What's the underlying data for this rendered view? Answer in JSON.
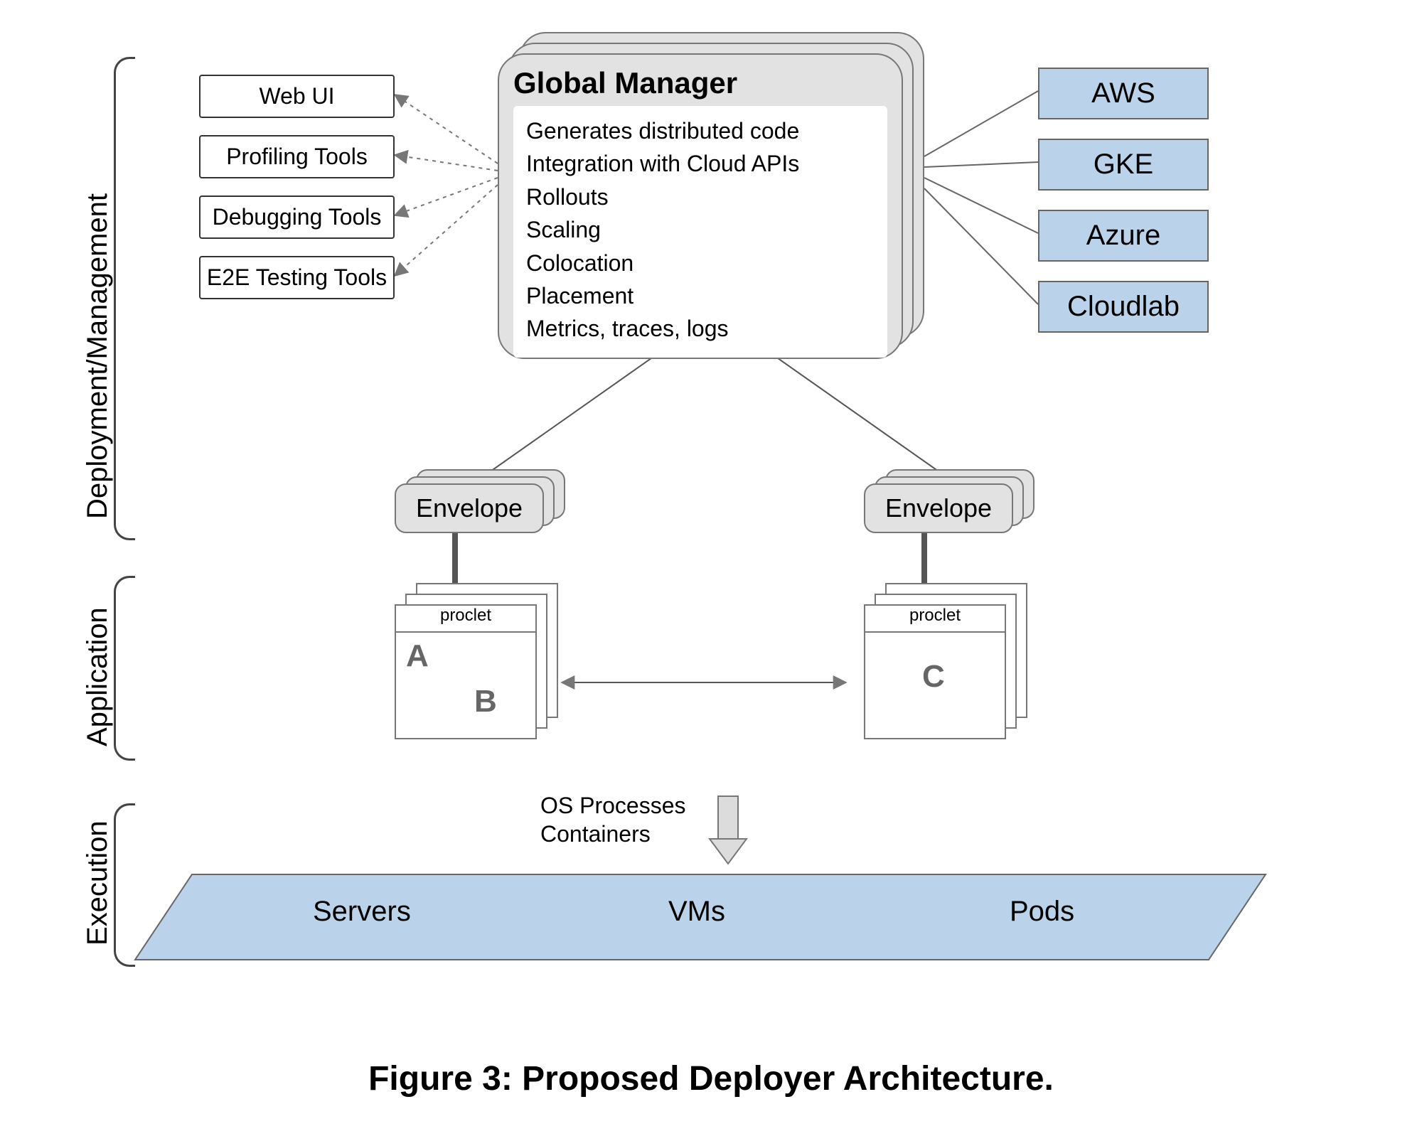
{
  "sections": {
    "deployment": "Deployment/Management",
    "application": "Application",
    "execution": "Execution"
  },
  "tools": [
    "Web UI",
    "Profiling Tools",
    "Debugging Tools",
    "E2E Testing Tools"
  ],
  "globalManager": {
    "title": "Global Manager",
    "items": [
      "Generates distributed code",
      "Integration with Cloud APIs",
      "Rollouts",
      "Scaling",
      "Colocation",
      "Placement",
      "Metrics, traces, logs"
    ]
  },
  "clouds": [
    "AWS",
    "GKE",
    "Azure",
    "Cloudlab"
  ],
  "envelope": "Envelope",
  "proclet": "proclet",
  "procletGroups": {
    "left": [
      "A",
      "B"
    ],
    "right": [
      "C"
    ]
  },
  "osLabel": {
    "l1": "OS Processes",
    "l2": "Containers"
  },
  "execRow": [
    "Servers",
    "VMs",
    "Pods"
  ],
  "caption": "Figure 3: Proposed Deployer Architecture."
}
